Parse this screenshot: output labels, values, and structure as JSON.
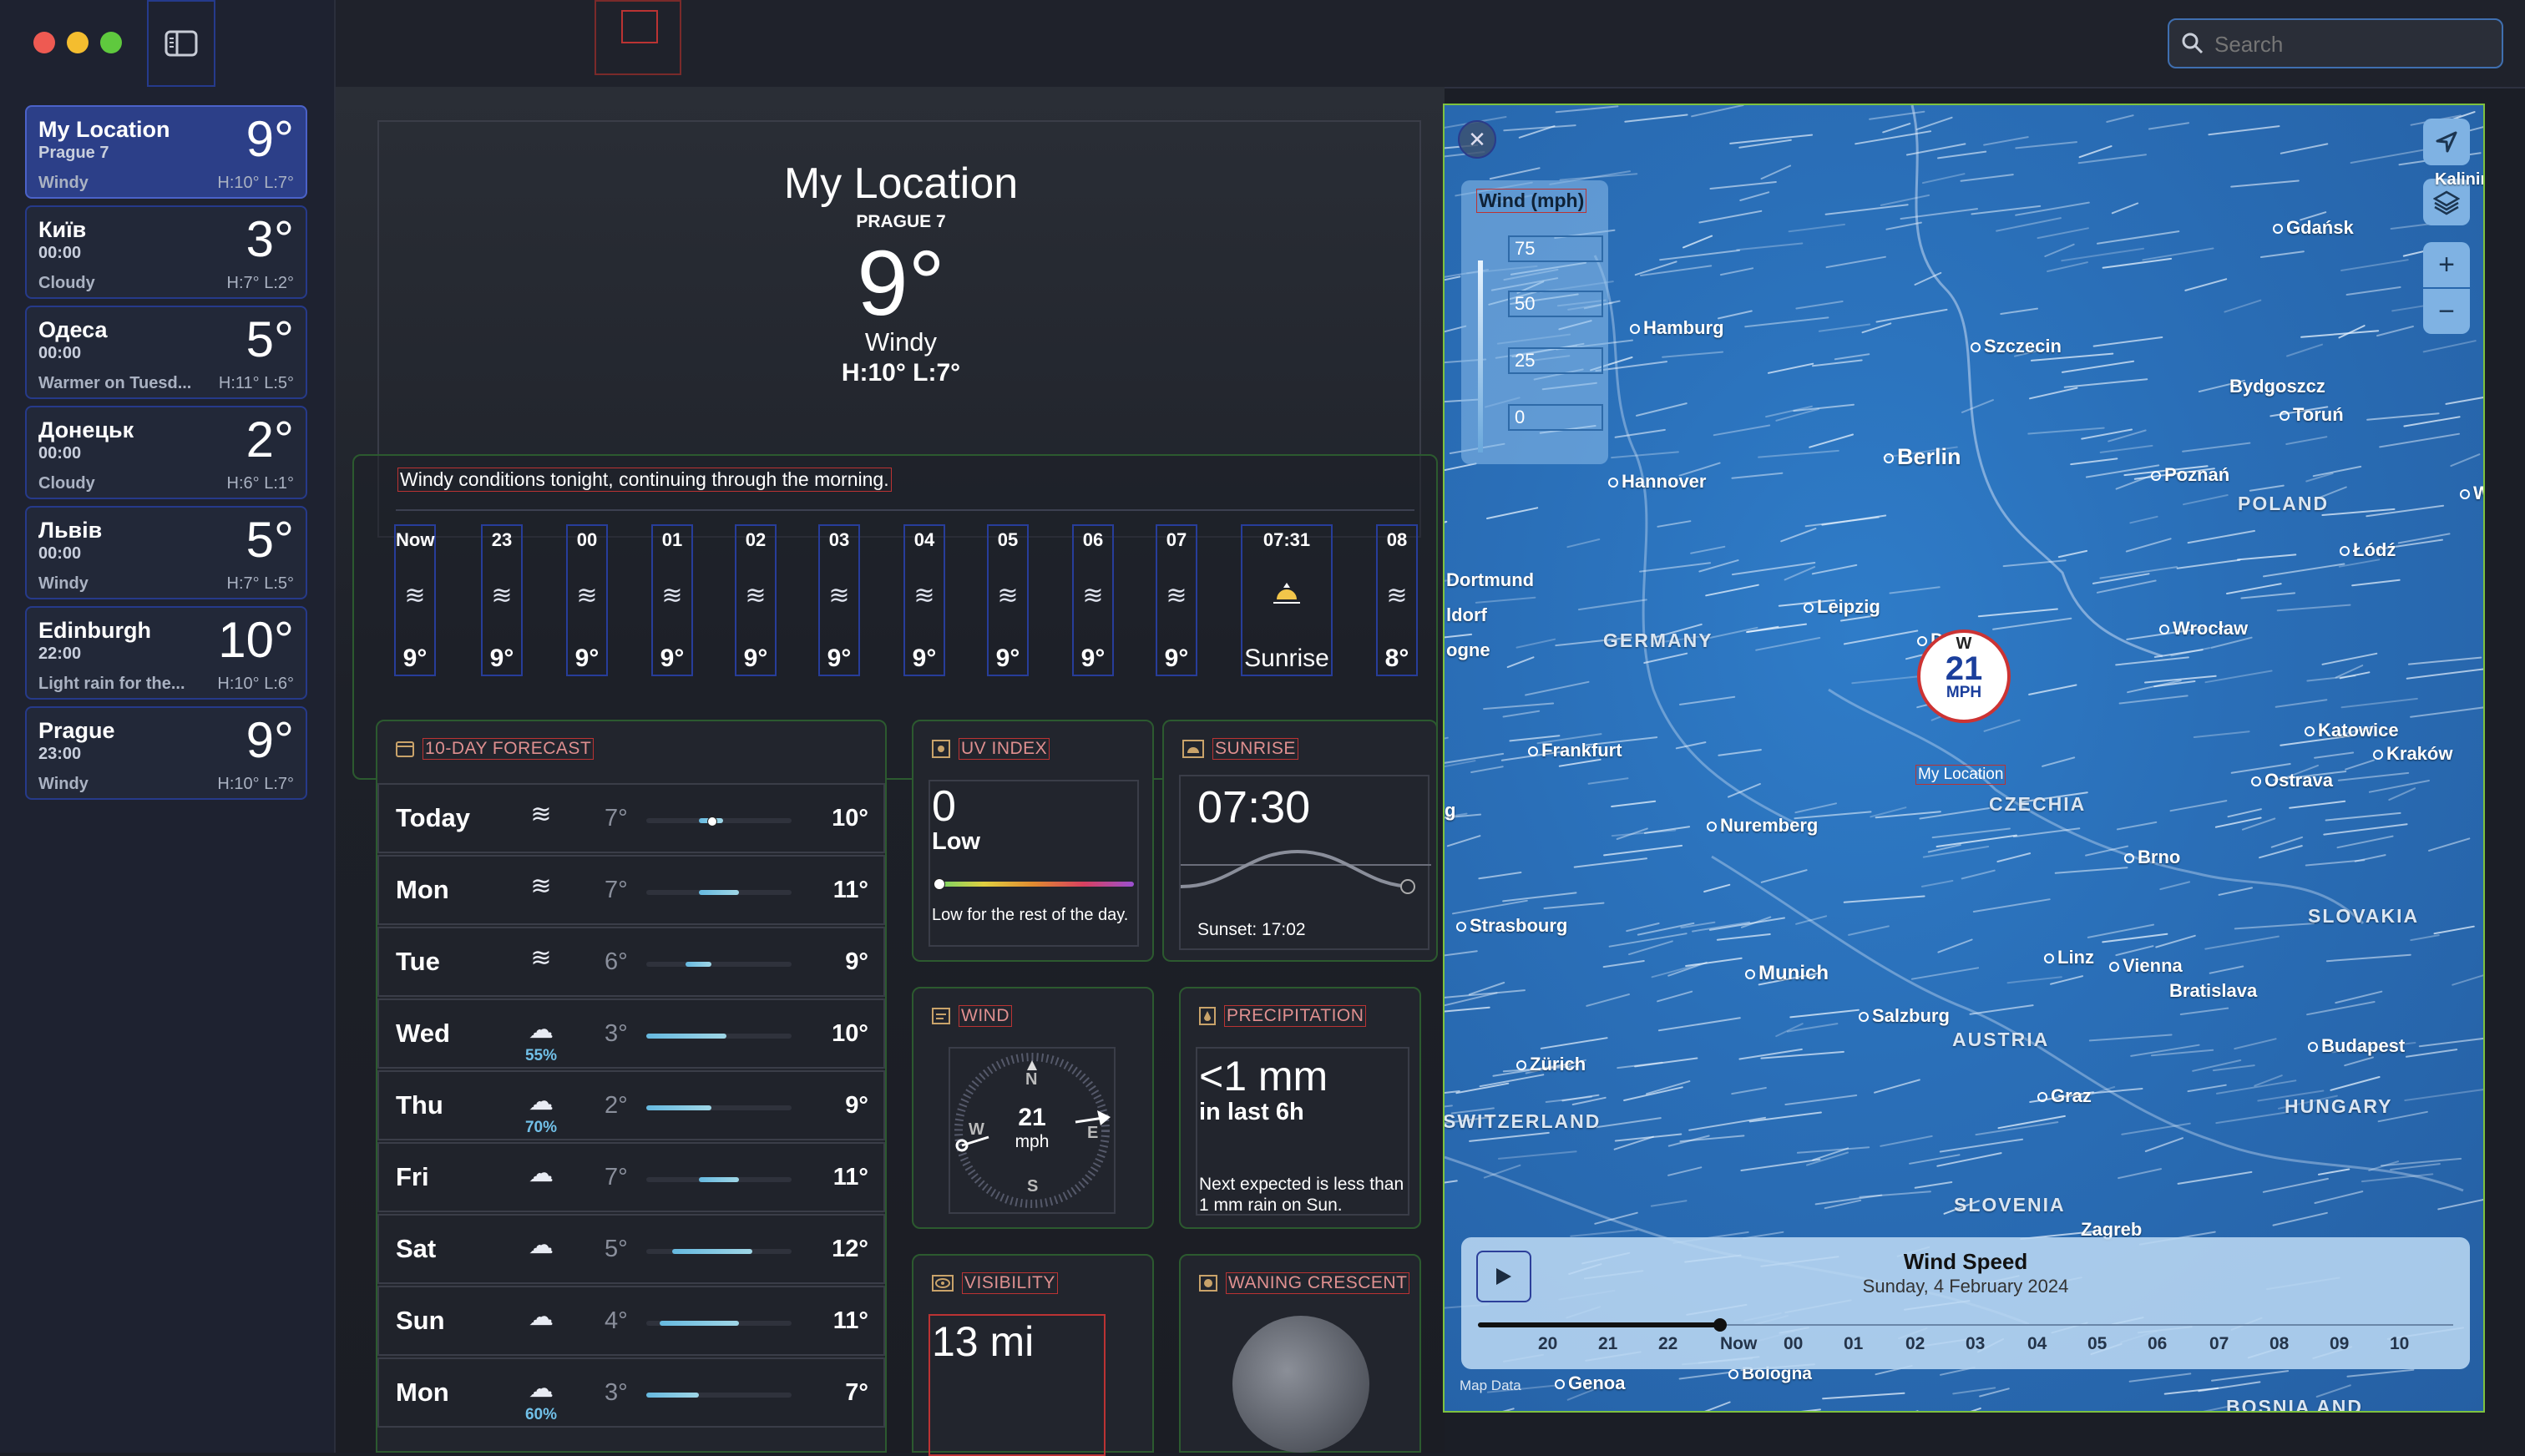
{
  "window": {
    "search_placeholder": "Search"
  },
  "locations": [
    {
      "name": "My Location",
      "sub": "Prague 7",
      "temp": "9°",
      "condition": "Windy",
      "hilo": "H:10°  L:7°",
      "selected": true
    },
    {
      "name": "Київ",
      "sub": "00:00",
      "temp": "3°",
      "condition": "Cloudy",
      "hilo": "H:7°  L:2°"
    },
    {
      "name": "Одеса",
      "sub": "00:00",
      "temp": "5°",
      "condition": "Warmer on Tuesd...",
      "hilo": "H:11°  L:5°"
    },
    {
      "name": "Донецьк",
      "sub": "00:00",
      "temp": "2°",
      "condition": "Cloudy",
      "hilo": "H:6°  L:1°"
    },
    {
      "name": "Львів",
      "sub": "00:00",
      "temp": "5°",
      "condition": "Windy",
      "hilo": "H:7°  L:5°"
    },
    {
      "name": "Edinburgh",
      "sub": "22:00",
      "temp": "10°",
      "condition": "Light rain for the...",
      "hilo": "H:10°  L:6°"
    },
    {
      "name": "Prague",
      "sub": "23:00",
      "temp": "9°",
      "condition": "Windy",
      "hilo": "H:10°  L:7°"
    }
  ],
  "current": {
    "title": "My Location",
    "subtitle": "PRAGUE 7",
    "temp": "9°",
    "condition": "Windy",
    "hilo": "H:10°  L:7°"
  },
  "summary": "Windy conditions tonight, continuing through the morning.",
  "hourly": [
    {
      "time": "Now",
      "icon": "wind-icon",
      "value": "9°"
    },
    {
      "time": "23",
      "icon": "wind-icon",
      "value": "9°"
    },
    {
      "time": "00",
      "icon": "wind-icon",
      "value": "9°"
    },
    {
      "time": "01",
      "icon": "wind-icon",
      "value": "9°"
    },
    {
      "time": "02",
      "icon": "wind-icon",
      "value": "9°"
    },
    {
      "time": "03",
      "icon": "wind-icon",
      "value": "9°"
    },
    {
      "time": "04",
      "icon": "wind-icon",
      "value": "9°"
    },
    {
      "time": "05",
      "icon": "wind-icon",
      "value": "9°"
    },
    {
      "time": "06",
      "icon": "wind-icon",
      "value": "9°"
    },
    {
      "time": "07",
      "icon": "wind-icon",
      "value": "9°"
    },
    {
      "time": "07:31",
      "icon": "sunrise-icon",
      "value": "Sunrise"
    },
    {
      "time": "08",
      "icon": "wind-icon",
      "value": "8°"
    }
  ],
  "forecast": {
    "title": "10-DAY FORECAST",
    "days": [
      {
        "day": "Today",
        "icon": "wind-icon",
        "precip": "",
        "low": "7°",
        "high": "10°",
        "bar_start": 0.36,
        "bar_end": 0.53,
        "current_dot": 0.42
      },
      {
        "day": "Mon",
        "icon": "wind-icon",
        "precip": "",
        "low": "7°",
        "high": "11°",
        "bar_start": 0.36,
        "bar_end": 0.64
      },
      {
        "day": "Tue",
        "icon": "wind-icon",
        "precip": "",
        "low": "6°",
        "high": "9°",
        "bar_start": 0.27,
        "bar_end": 0.45
      },
      {
        "day": "Wed",
        "icon": "cloud-rain-icon",
        "precip": "55%",
        "low": "3°",
        "high": "10°",
        "bar_start": 0.0,
        "bar_end": 0.55
      },
      {
        "day": "Thu",
        "icon": "cloud-rain-icon",
        "precip": "70%",
        "low": "2°",
        "high": "9°",
        "bar_start": -0.09,
        "bar_end": 0.45
      },
      {
        "day": "Fri",
        "icon": "cloud-icon",
        "precip": "",
        "low": "7°",
        "high": "11°",
        "bar_start": 0.36,
        "bar_end": 0.64
      },
      {
        "day": "Sat",
        "icon": "cloud-icon",
        "precip": "",
        "low": "5°",
        "high": "12°",
        "bar_start": 0.18,
        "bar_end": 0.73
      },
      {
        "day": "Sun",
        "icon": "cloud-icon",
        "precip": "",
        "low": "4°",
        "high": "11°",
        "bar_start": 0.09,
        "bar_end": 0.64
      },
      {
        "day": "Mon",
        "icon": "cloud-rain-icon",
        "precip": "60%",
        "low": "3°",
        "high": "7°",
        "bar_start": 0.0,
        "bar_end": 0.36
      }
    ]
  },
  "uv": {
    "title": "UV INDEX",
    "value": "0",
    "level": "Low",
    "note": "Low for the rest of the day.",
    "level_fraction": 0.0
  },
  "sunrise": {
    "title": "SUNRISE",
    "time": "07:30",
    "note": "Sunset: 17:02"
  },
  "wind": {
    "title": "WIND",
    "speed": "21",
    "unit": "mph",
    "n": "N",
    "s": "S",
    "e": "E",
    "w": "W"
  },
  "precipitation": {
    "title": "PRECIPITATION",
    "amount": "<1 mm",
    "period": "in last 6h",
    "note": "Next expected is less than 1 mm rain on Sun."
  },
  "visibility": {
    "title": "VISIBILITY",
    "value": "13 mi"
  },
  "moon": {
    "title": "WANING CRESCENT"
  },
  "map": {
    "legend_title": "Wind (mph)",
    "legend_values": [
      "75",
      "50",
      "25",
      "0"
    ],
    "marker": {
      "dir": "W",
      "speed": "21",
      "unit": "MPH",
      "label": "My Location"
    },
    "cities": [
      "Gdańsk",
      "Hamburg",
      "Szczecin",
      "Bydgoszcz",
      "Toruń",
      "Berlin",
      "Hannover",
      "Poznań",
      "Dortmund",
      "ldorf",
      "ogne",
      "Leipzig",
      "Łódź",
      "Wrocław",
      "Frankfurt",
      "Katowice",
      "Kraków",
      "Ostrava",
      "Nuremberg",
      "Brno",
      "Strasbourg",
      "Munich",
      "Linz",
      "Vienna",
      "Bratislava",
      "Salzburg",
      "Zürich",
      "Budapest",
      "Graz",
      "Zagreb",
      "Genoa",
      "Bologna",
      "Kalinin",
      "Wa",
      "g",
      "Dr"
    ],
    "countries": [
      "GERMANY",
      "POLAND",
      "CZECHIA",
      "SLOVAKIA",
      "AUSTRIA",
      "HUNGARY",
      "SWITZERLAND",
      "SLOVENIA",
      "BOSNIA AND"
    ],
    "timeline_title": "Wind Speed",
    "timeline_date": "Sunday, 4 February 2024",
    "timeline_labels": [
      "20",
      "21",
      "22",
      "Now",
      "00",
      "01",
      "02",
      "03",
      "04",
      "05",
      "06",
      "07",
      "08",
      "09",
      "10"
    ],
    "map_data": "Map Data"
  },
  "colors": {
    "accent": "#4b62c8",
    "map_blue": "#2a6fb8",
    "uv_gradient": [
      "#6ad46a",
      "#e0d040",
      "#e08a30",
      "#d84060",
      "#9a50d0"
    ]
  }
}
